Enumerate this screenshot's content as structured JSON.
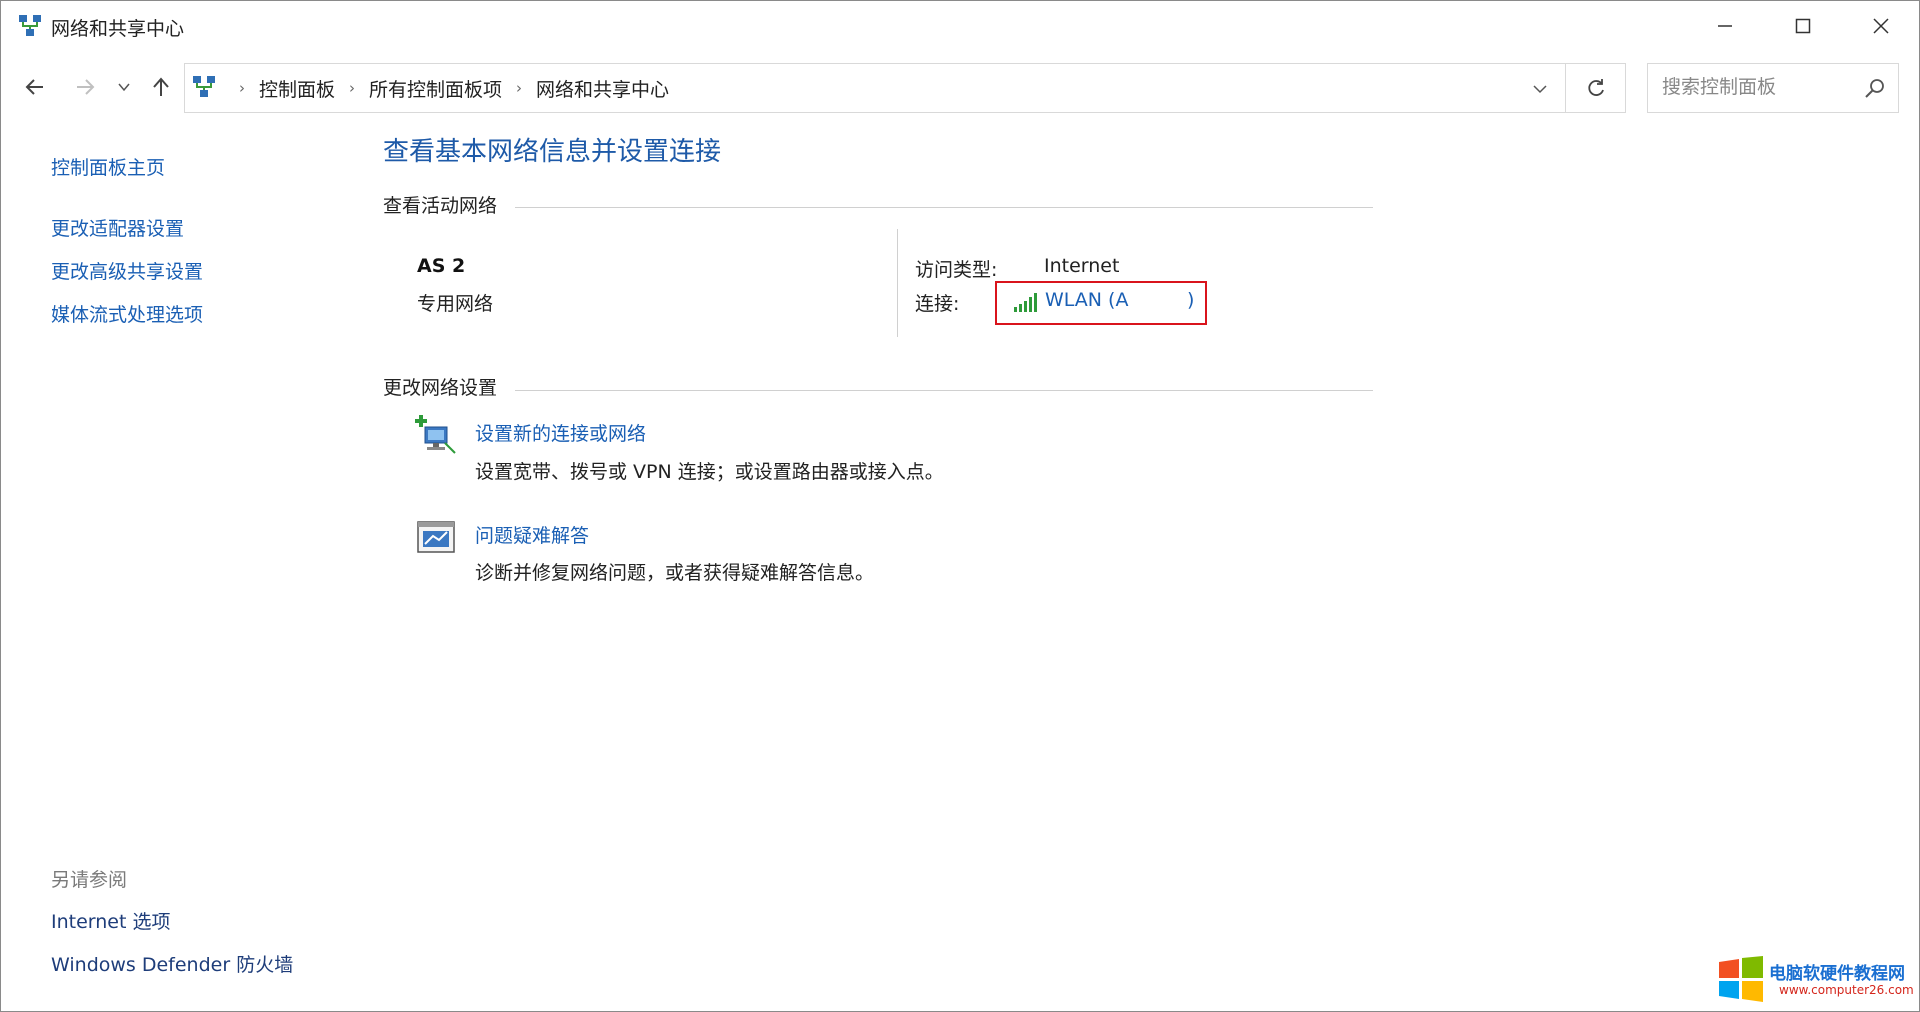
{
  "window": {
    "title": "网络和共享中心",
    "icons": {
      "app": "network-center-icon",
      "minimize": "minimize-icon",
      "maximize": "maximize-icon",
      "close": "close-icon"
    }
  },
  "nav": {
    "back_icon": "arrow-left-icon",
    "forward_icon": "arrow-right-icon",
    "recent_icon": "chevron-down-icon",
    "up_icon": "arrow-up-icon",
    "breadcrumbs": [
      "控制面板",
      "所有控制面板项",
      "网络和共享中心"
    ],
    "refresh_icon": "refresh-icon",
    "search_placeholder": "搜索控制面板"
  },
  "sidebar": {
    "items": [
      {
        "label": "控制面板主页"
      },
      {
        "label": "更改适配器设置"
      },
      {
        "label": "更改高级共享设置"
      },
      {
        "label": "媒体流式处理选项"
      }
    ],
    "see_also_title": "另请参阅",
    "see_also": [
      {
        "label": "Internet 选项"
      },
      {
        "label": "Windows Defender 防火墙"
      }
    ]
  },
  "main": {
    "title": "查看基本网络信息并设置连接",
    "active_section": "查看活动网络",
    "network": {
      "name": "AS        2",
      "type": "专用网络",
      "access_label": "访问类型:",
      "access_value": "Internet",
      "connection_label": "连接:",
      "connection_value": "WLAN (A",
      "connection_value_end": ")"
    },
    "change_section": "更改网络设置",
    "tasks": [
      {
        "link": "设置新的连接或网络",
        "desc": "设置宽带、拨号或 VPN 连接；或设置路由器或接入点。",
        "icon": "new-connection-icon"
      },
      {
        "link": "问题疑难解答",
        "desc": "诊断并修复网络问题，或者获得疑难解答信息。",
        "icon": "troubleshoot-icon"
      }
    ]
  },
  "watermark": {
    "name": "电脑软硬件教程网",
    "url": "www.computer26.com"
  },
  "colors": {
    "link": "#1a5fb4",
    "title": "#1e5aa8",
    "highlight_box": "#d9141c"
  }
}
